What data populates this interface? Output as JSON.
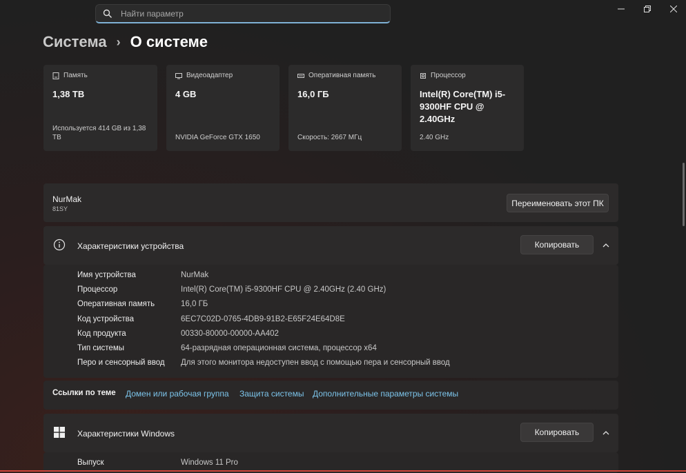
{
  "search": {
    "placeholder": "Найти параметр"
  },
  "breadcrumb": {
    "parent": "Система",
    "separator": "›",
    "current": "О системе"
  },
  "cards": [
    {
      "icon": "storage-icon",
      "title": "Память",
      "value": "1,38 TB",
      "sub": "Используется 414 GB из 1,38 TB"
    },
    {
      "icon": "gpu-icon",
      "title": "Видеоадаптер",
      "value": "4 GB",
      "sub": "NVIDIA GeForce GTX 1650"
    },
    {
      "icon": "ram-icon",
      "title": "Оперативная память",
      "value": "16,0 ГБ",
      "sub": "Скорость: 2667 МГц"
    },
    {
      "icon": "cpu-icon",
      "title": "Процессор",
      "value": "Intel(R) Core(TM) i5-9300HF CPU @ 2.40GHz",
      "sub": "2.40 GHz"
    }
  ],
  "pc": {
    "name": "NurMak",
    "model": "81SY",
    "rename_label": "Переименовать этот ПК"
  },
  "device_specs": {
    "title": "Характеристики устройства",
    "copy_label": "Копировать",
    "rows": [
      {
        "label": "Имя устройства",
        "value": "NurMak"
      },
      {
        "label": "Процессор",
        "value": "Intel(R) Core(TM) i5-9300HF CPU @ 2.40GHz (2.40 GHz)"
      },
      {
        "label": "Оперативная память",
        "value": "16,0 ГБ"
      },
      {
        "label": "Код устройства",
        "value": "6EC7C02D-0765-4DB9-91B2-E65F24E64D8E"
      },
      {
        "label": "Код продукта",
        "value": "00330-80000-00000-AA402"
      },
      {
        "label": "Тип системы",
        "value": "64-разрядная операционная система, процессор x64"
      },
      {
        "label": "Перо и сенсорный ввод",
        "value": "Для этого монитора недоступен ввод с помощью пера и сенсорный ввод"
      }
    ]
  },
  "related_links": {
    "title": "Ссылки по теме",
    "links": [
      "Домен или рабочая группа",
      "Защита системы",
      "Дополнительные параметры системы"
    ]
  },
  "windows_specs": {
    "title": "Характеристики Windows",
    "copy_label": "Копировать",
    "rows": [
      {
        "label": "Выпуск",
        "value": "Windows 11 Pro"
      }
    ]
  },
  "colors": {
    "accent_link": "#7cc4ea",
    "search_focus": "#7fb2d6"
  }
}
